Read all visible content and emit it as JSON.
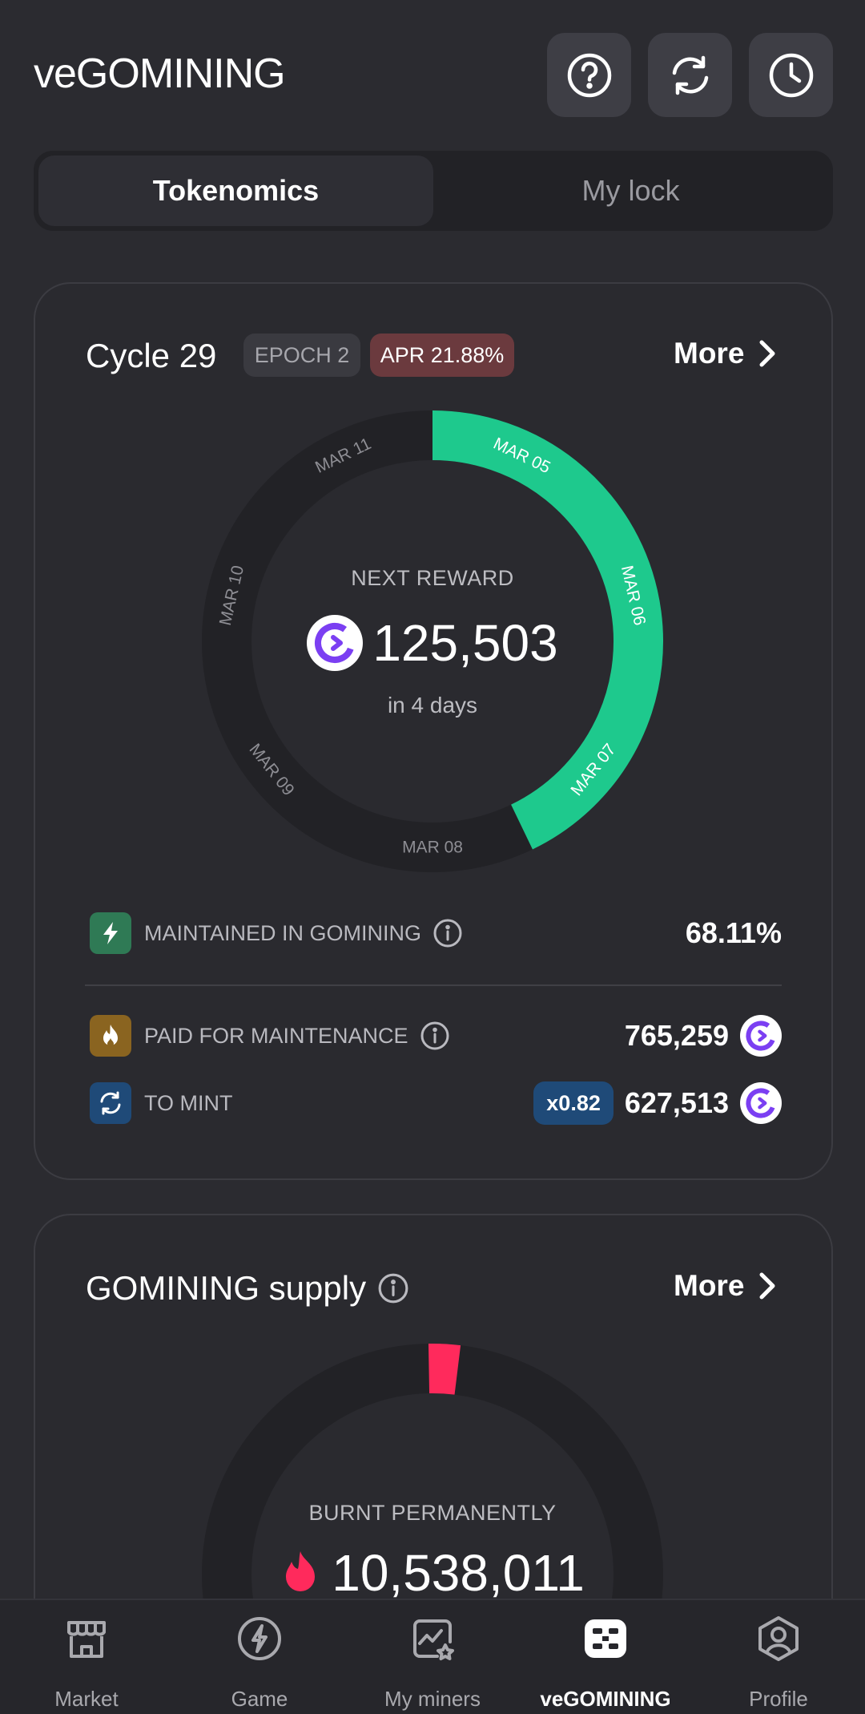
{
  "header": {
    "title": "veGOMINING",
    "icons": [
      "help-icon",
      "refresh-icon",
      "history-icon"
    ]
  },
  "tabs": [
    {
      "label": "Tokenomics",
      "active": true
    },
    {
      "label": "My lock",
      "active": false
    }
  ],
  "cycle_card": {
    "title": "Cycle 29",
    "epoch_badge": "EPOCH 2",
    "apr_badge": "APR 21.88%",
    "more_label": "More",
    "ring": {
      "days": [
        "MAR 05",
        "MAR 06",
        "MAR 07",
        "MAR 08",
        "MAR 09",
        "MAR 10",
        "MAR 11"
      ],
      "elapsed_days": 3,
      "total_days": 7,
      "progress_color": "#1ec98d",
      "track_color": "#222226"
    },
    "next_reward_label": "NEXT REWARD",
    "next_reward_value": "125,503",
    "next_reward_time": "in 4 days",
    "stats": [
      {
        "label": "MAINTAINED IN GOMINING",
        "value": "68.11%",
        "icon": "lightning-icon",
        "icon_bg": "#2f7a55"
      },
      {
        "label": "PAID FOR MAINTENANCE",
        "value": "765,259",
        "icon": "flame-icon",
        "icon_bg": "#8a6420"
      },
      {
        "label": "TO MINT",
        "value": "627,513",
        "multiplier": "x0.82",
        "icon": "refresh-icon",
        "icon_bg": "#1f4a78"
      }
    ]
  },
  "supply_card": {
    "title": "GOMINING supply",
    "more_label": "More",
    "burnt_label": "BURNT PERMANENTLY",
    "burnt_value": "10,538,011",
    "burnt_color": "#ff2a5c"
  },
  "bottom_nav": [
    {
      "label": "Market",
      "icon": "market-icon",
      "active": false
    },
    {
      "label": "Game",
      "icon": "game-icon",
      "active": false
    },
    {
      "label": "My miners",
      "icon": "miners-icon",
      "active": false
    },
    {
      "label": "veGOMINING",
      "icon": "vegomining-icon",
      "active": true
    },
    {
      "label": "Profile",
      "icon": "profile-icon",
      "active": false
    }
  ]
}
